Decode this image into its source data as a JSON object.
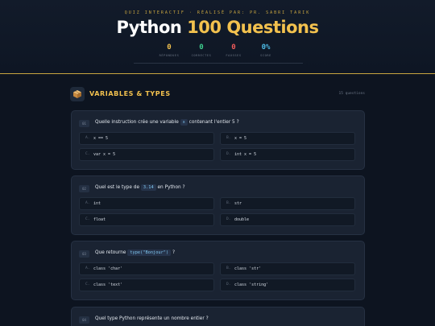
{
  "header": {
    "subtitle": "QUIZ INTERACTIF · RÉALISÉ PAR: PR. SABRI TARIK",
    "title_part1": "Python",
    "title_part2": "100 Questions",
    "stats": [
      {
        "value": "0",
        "label": "RÉPONDUES",
        "color": "#f2c14e"
      },
      {
        "value": "0",
        "label": "CORRECTES",
        "color": "#3ecf8e"
      },
      {
        "value": "0",
        "label": "FAUSSES",
        "color": "#ef5b5b"
      },
      {
        "value": "0%",
        "label": "SCORE",
        "color": "#4dbbe6"
      }
    ],
    "progress_percent": 0
  },
  "category": {
    "icon": "box-icon",
    "title": "VARIABLES & TYPES",
    "count": "15 questions"
  },
  "questions": [
    {
      "num": "01",
      "text_before": "Quelle instruction crée une variable",
      "code": "x",
      "text_after": "contenant l'entier 5 ?",
      "options": [
        {
          "letter": "A.",
          "text": "x == 5"
        },
        {
          "letter": "B.",
          "text": "x = 5"
        },
        {
          "letter": "C.",
          "text": "var x = 5"
        },
        {
          "letter": "D.",
          "text": "int x = 5"
        }
      ]
    },
    {
      "num": "02",
      "text_before": "Quel est le type de",
      "code": "3.14",
      "text_after": "en Python ?",
      "options": [
        {
          "letter": "A.",
          "text": "int"
        },
        {
          "letter": "B.",
          "text": "str"
        },
        {
          "letter": "C.",
          "text": "float"
        },
        {
          "letter": "D.",
          "text": "double"
        }
      ]
    },
    {
      "num": "03",
      "text_before": "Que retourne",
      "code": "type(\"Bonjour\")",
      "text_after": "?",
      "options": [
        {
          "letter": "A.",
          "text": "class 'char'"
        },
        {
          "letter": "B.",
          "text": "class 'str'"
        },
        {
          "letter": "C.",
          "text": "class 'text'"
        },
        {
          "letter": "D.",
          "text": "class 'string'"
        }
      ]
    },
    {
      "num": "04",
      "text_before": "Quel type Python représente un nombre entier ?",
      "code": "",
      "text_after": ""
    }
  ]
}
